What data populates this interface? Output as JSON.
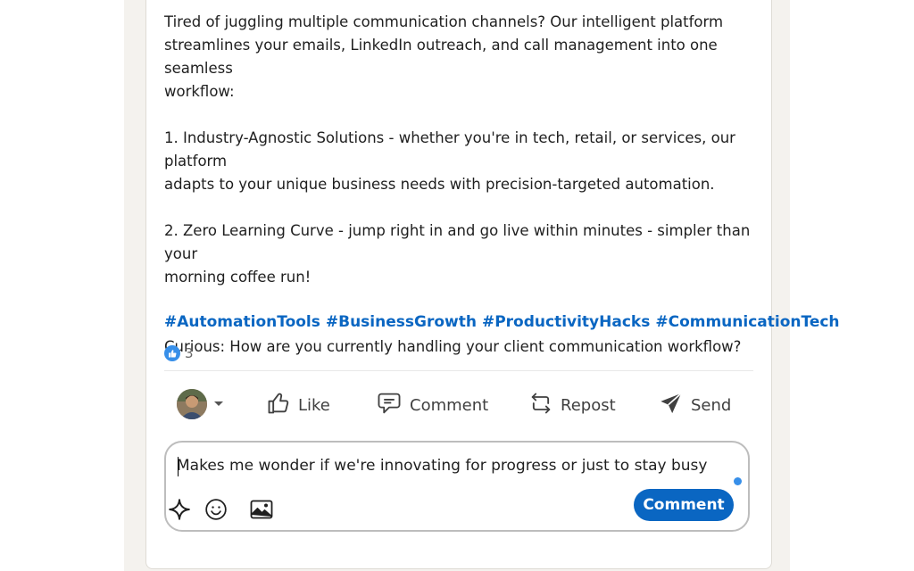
{
  "post": {
    "body": "Tired of juggling multiple communication channels? Our intelligent platform\nstreamlines your emails, LinkedIn outreach, and call management into one seamless\nworkflow:\n\n1. Industry-Agnostic Solutions - whether you're in tech, retail, or services, our platform\nadapts to your unique business needs with precision-targeted automation.\n\n2. Zero Learning Curve - jump right in and go live within minutes - simpler than your\nmorning coffee run!\n\n\nCurious: How are you currently handling your client communication workflow?",
    "hashtags": [
      "#AutomationTools",
      "#BusinessGrowth",
      "#ProductivityHacks",
      "#CommunicationTech"
    ],
    "reaction_count": "3"
  },
  "actions": {
    "like": "Like",
    "comment": "Comment",
    "repost": "Repost",
    "send": "Send"
  },
  "composer": {
    "value": "Makes me wonder if we're innovating for progress or just to stay busy",
    "submit_label": "Comment"
  },
  "colors": {
    "brand": "#0a66c2",
    "like_badge": "#378fe9",
    "text": "#1f1f1f"
  },
  "icons": [
    "like-icon",
    "comment-icon",
    "repost-icon",
    "send-icon",
    "sparkle-icon",
    "emoji-icon",
    "image-icon",
    "chevron-down-icon"
  ]
}
